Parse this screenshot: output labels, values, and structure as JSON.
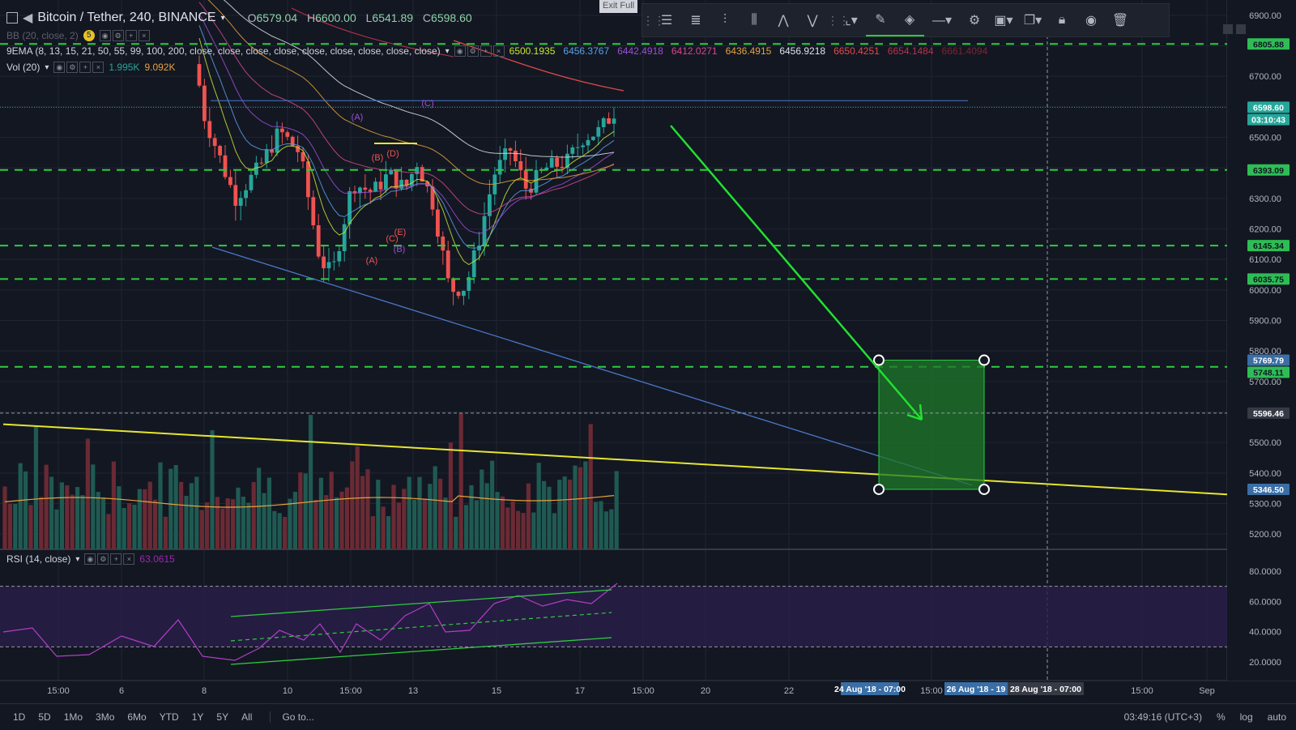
{
  "header": {
    "symbol": "Bitcoin / Tether, 240, BINANCE",
    "open_label": "O",
    "open": "6579.04",
    "high_label": "H",
    "high": "6600.00",
    "low_label": "L",
    "low": "6541.89",
    "close_label": "C",
    "close": "6598.60",
    "exit_fullscreen": "Exit Full"
  },
  "indicators": {
    "bb": {
      "label": "BB (20, close, 2)",
      "badge": "5"
    },
    "ema": {
      "label": "9EMA (8, 13, 15, 21, 50, 55, 99, 100, 200, close, close, close, close, close, close, close, close, close)",
      "values": [
        {
          "v": "6500.1935",
          "color": "#c8e632"
        },
        {
          "v": "6456.3767",
          "color": "#5aa0e6"
        },
        {
          "v": "6442.4918",
          "color": "#9c4fd6"
        },
        {
          "v": "6412.0271",
          "color": "#d6488f"
        },
        {
          "v": "6436.4915",
          "color": "#e6a23c"
        },
        {
          "v": "6456.9218",
          "color": "#e0e3eb"
        },
        {
          "v": "6650.4251",
          "color": "#e04a4a"
        },
        {
          "v": "6654.1484",
          "color": "#b8324a"
        },
        {
          "v": "6661.4094",
          "color": "#7a2530"
        }
      ]
    },
    "vol": {
      "label": "Vol (20)",
      "v1": "1.995K",
      "v2": "9.092K"
    },
    "rsi": {
      "label": "RSI (14, close)",
      "value": "63.0615"
    }
  },
  "price_axis": {
    "ticks": [
      "6900.00",
      "6800.00",
      "6700.00",
      "6600.00",
      "6500.00",
      "6400.00",
      "6300.00",
      "6200.00",
      "6100.00",
      "6000.00",
      "5900.00",
      "5800.00",
      "5700.00",
      "5600.00",
      "5500.00",
      "5400.00",
      "5300.00",
      "5200.00"
    ],
    "labels": [
      {
        "text": "6805.88",
        "price": 6805.88,
        "bg": "#2ebd55",
        "fg": "#131722"
      },
      {
        "text": "6598.60",
        "price": 6598.6,
        "bg": "#26a69a",
        "fg": "#ffffff"
      },
      {
        "text": "03:10:43",
        "price": 6558,
        "bg": "#26a69a",
        "fg": "#ffffff"
      },
      {
        "text": "6393.09",
        "price": 6393.09,
        "bg": "#2ebd55",
        "fg": "#131722"
      },
      {
        "text": "6145.34",
        "price": 6145.34,
        "bg": "#2ebd55",
        "fg": "#131722"
      },
      {
        "text": "6035.75",
        "price": 6035.75,
        "bg": "#2ebd55",
        "fg": "#131722"
      },
      {
        "text": "5769.79",
        "price": 5769.79,
        "bg": "#3a6ea5",
        "fg": "#ffffff"
      },
      {
        "text": "5748.11",
        "price": 5730,
        "bg": "#2ebd55",
        "fg": "#131722"
      },
      {
        "text": "5596.46",
        "price": 5596.46,
        "bg": "#363a45",
        "fg": "#ffffff"
      },
      {
        "text": "5346.50",
        "price": 5346.5,
        "bg": "#3a6ea5",
        "fg": "#ffffff"
      }
    ]
  },
  "rsi_axis": {
    "ticks": [
      "80.0000",
      "60.0000",
      "40.0000",
      "20.0000"
    ]
  },
  "time_axis": {
    "ticks": [
      "15:00",
      "6",
      "8",
      "10",
      "15:00",
      "13",
      "15",
      "17",
      "15:00",
      "20",
      "22",
      "15:00",
      "15:00",
      "Sep"
    ],
    "highlights": [
      "24 Aug '18 - 07:00",
      "26 Aug '18 - 19",
      "28 Aug '18 - 07:00"
    ]
  },
  "elliott_labels": [
    "(A)",
    "(B)",
    "(D)",
    "(E)",
    "(C)",
    "(B)",
    "(A)",
    "(C)"
  ],
  "chart_data": {
    "type": "candlestick",
    "title": "Bitcoin / Tether, 240, BINANCE",
    "ylim": [
      5150,
      6950
    ],
    "horizontal_levels": [
      6805.88,
      6393.09,
      6145.34,
      6035.75,
      5748.11
    ],
    "target_box": {
      "top": 5769.79,
      "bottom": 5346.5
    },
    "crosshair_price": 5596.46,
    "last_price": 6598.6
  },
  "bottom_bar": {
    "timeframes": [
      "1D",
      "5D",
      "1Mo",
      "3Mo",
      "6Mo",
      "YTD",
      "1Y",
      "5Y",
      "All"
    ],
    "goto": "Go to...",
    "clock": "03:49:16 (UTC+3)",
    "pct": "%",
    "log": "log",
    "auto": "auto"
  },
  "colors": {
    "bg": "#131722",
    "up": "#26a69a",
    "down": "#ef5350",
    "level": "#2ecc40",
    "trend_yellow": "#e6e62e",
    "trend_blue": "#4a78c8"
  }
}
